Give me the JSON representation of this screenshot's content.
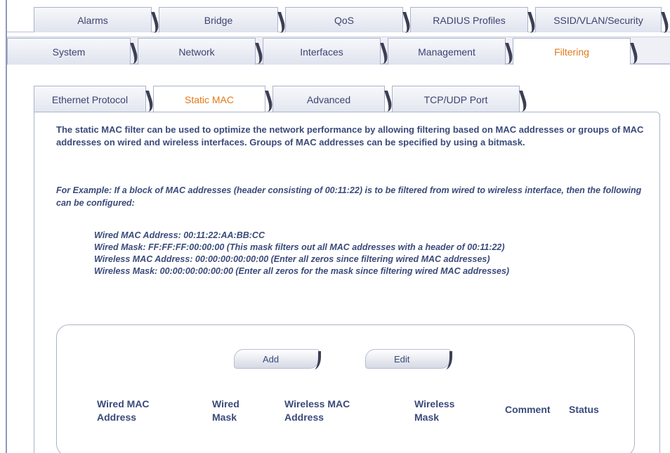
{
  "top_tabs": {
    "row1": [
      "Alarms",
      "Bridge",
      "QoS",
      "RADIUS Profiles",
      "SSID/VLAN/Security"
    ],
    "row2": [
      "System",
      "Network",
      "Interfaces",
      "Management",
      "Filtering"
    ],
    "active_row2": "Filtering"
  },
  "sub_tabs": {
    "items": [
      "Ethernet Protocol",
      "Static MAC",
      "Advanced",
      "TCP/UDP Port"
    ],
    "active": "Static MAC"
  },
  "description": "The static MAC filter can be used to optimize the network performance by allowing filtering based on MAC addresses or groups of MAC addresses on wired and wireless interfaces. Groups of MAC addresses can be specified by using a bitmask.",
  "example": {
    "intro": "For Example: If a block of MAC addresses (header consisting of 00:11:22) is to be filtered from wired to wireless interface, then the following can be configured:",
    "lines": [
      "Wired MAC Address: 00:11:22:AA:BB:CC",
      "Wired Mask: FF:FF:FF:00:00:00 (This mask filters out all MAC addresses with a header of 00:11:22)",
      "Wireless MAC Address: 00:00:00:00:00:00 (Enter all zeros since filtering wired MAC addresses)",
      "Wireless Mask: 00:00:00:00:00:00 (Enter all zeros for the mask since filtering wired MAC addresses)"
    ]
  },
  "buttons": {
    "add": "Add",
    "edit": "Edit"
  },
  "table": {
    "headers": [
      [
        "Wired MAC",
        "Address"
      ],
      [
        "Wired",
        "Mask"
      ],
      [
        "Wireless MAC",
        "Address"
      ],
      [
        "Wireless",
        "Mask"
      ],
      [
        "Comment"
      ],
      [
        "Status"
      ]
    ]
  },
  "colors": {
    "active_tab": "#e07a1b",
    "text": "#3a4a7a",
    "border": "#a9b3c9"
  }
}
